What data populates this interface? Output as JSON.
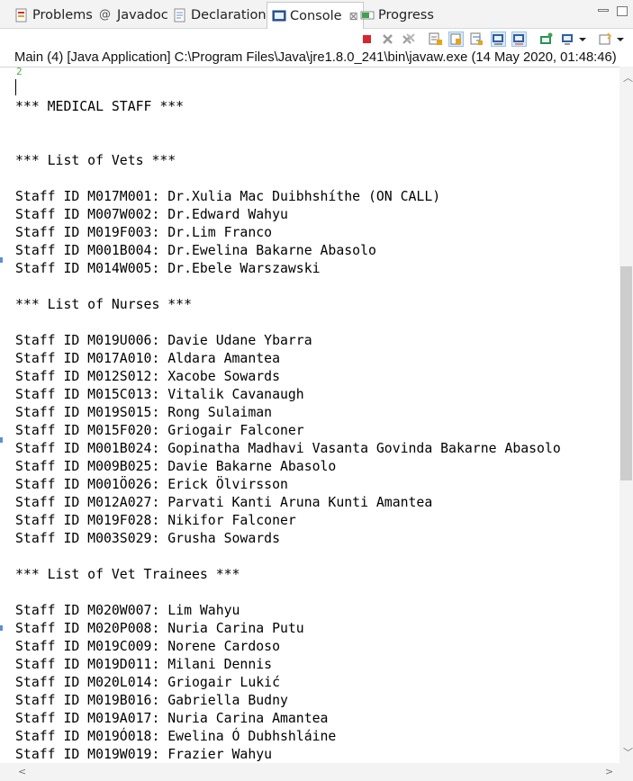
{
  "tabs": [
    {
      "label": "Problems",
      "icon": "problems-icon"
    },
    {
      "label": "Javadoc",
      "icon": "at-icon"
    },
    {
      "label": "Declaration",
      "icon": "declaration-icon"
    },
    {
      "label": "Console",
      "icon": "console-icon",
      "active": true,
      "close": "⊠"
    },
    {
      "label": "Progress",
      "icon": "progress-icon"
    }
  ],
  "process_label": "Main (4) [Java Application] C:\\Program Files\\Java\\jre1.8.0_241\\bin\\javaw.exe (14 May 2020, 01:48:46)",
  "console": {
    "ghost_char": "2",
    "lines": [
      "*** MEDICAL STAFF ***",
      "",
      "",
      "*** List of Vets ***",
      "",
      "Staff ID M017M001: Dr.Xulia Mac Duibhshíthe (ON CALL)",
      "Staff ID M007W002: Dr.Edward Wahyu",
      "Staff ID M019F003: Dr.Lim Franco",
      "Staff ID M001B004: Dr.Ewelina Bakarne Abasolo",
      "Staff ID M014W005: Dr.Ebele Warszawski",
      "",
      "*** List of Nurses ***",
      "",
      "Staff ID M019U006: Davie Udane Ybarra",
      "Staff ID M017A010: Aldara Amantea",
      "Staff ID M012S012: Xacobe Sowards",
      "Staff ID M015C013: Vitalik Cavanaugh",
      "Staff ID M019S015: Rong Sulaiman",
      "Staff ID M015F020: Griogair Falconer",
      "Staff ID M001B024: Gopinatha Madhavi Vasanta Govinda Bakarne Abasolo",
      "Staff ID M009B025: Davie Bakarne Abasolo",
      "Staff ID M001Ö026: Erick Ölvirsson",
      "Staff ID M012A027: Parvati Kanti Aruna Kunti Amantea",
      "Staff ID M019F028: Nikifor Falconer",
      "Staff ID M003S029: Grusha Sowards",
      "",
      "*** List of Vet Trainees ***",
      "",
      "Staff ID M020W007: Lim Wahyu",
      "Staff ID M020P008: Nuria Carina Putu",
      "Staff ID M019C009: Norene Cardoso",
      "Staff ID M019D011: Milani Dennis",
      "Staff ID M020L014: Griogair Lukić",
      "Staff ID M019B016: Gabriella Budny",
      "Staff ID M019A017: Nuria Carina Amantea",
      "Staff ID M019Ó018: Ewelina Ó Dubhshláine",
      "Staff ID M019W019: Frazier Wahyu"
    ]
  },
  "colors": {
    "terminate": "#d9262b",
    "active_tab_bg": "#ffffff",
    "tabbar_bg": "#f3f3f3",
    "scroll_thumb": "#cdcdcd"
  }
}
